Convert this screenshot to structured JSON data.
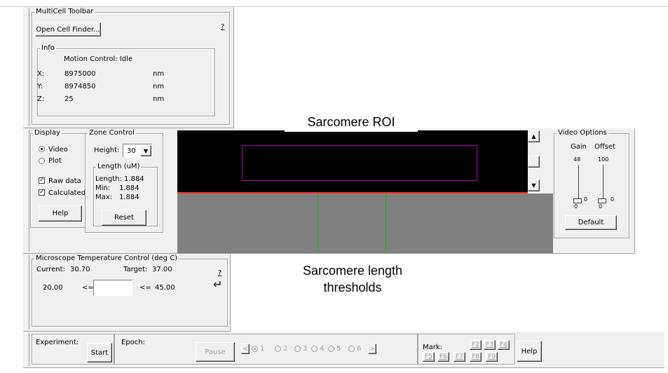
{
  "toolbar": {
    "title": "MultiCell Toolbar",
    "open_cell_finder": "Open Cell Finder...",
    "help_q": "?",
    "info": {
      "title": "Info",
      "motion_control": "Motion Control: Idle",
      "x_label": "X:",
      "x_value": "8975000",
      "x_unit": "nm",
      "y_label": "Y:",
      "y_value": "8974850",
      "y_unit": "nm",
      "z_label": "Z:",
      "z_value": "25",
      "z_unit": "nm"
    }
  },
  "display": {
    "title": "Display",
    "video": "Video",
    "plot": "Plot",
    "selected": "Video",
    "raw_data": "Raw data",
    "calculated": "Calculated",
    "raw_checked": true,
    "calc_checked": true,
    "help": "Help"
  },
  "zone": {
    "title": "Zone Control",
    "height_label": "Height:",
    "height_value": "30",
    "length_title": "Length (uM)",
    "length_line": "Length: 1.884",
    "min_label": "Min:",
    "min_value": "1.884",
    "max_label": "Max:",
    "max_value": "1.884",
    "reset": "Reset"
  },
  "video_options": {
    "title": "Video Options",
    "gain_label": "Gain",
    "offset_label": "Offset",
    "gain_max": "48",
    "offset_max": "100",
    "gain_min": "0",
    "offset_min": "0",
    "gain_value": "0",
    "offset_value": "0",
    "default": "Default"
  },
  "temperature": {
    "title": "Microscope Temperature Control (deg C)",
    "current_label": "Current:",
    "current_value": "30.70",
    "target_label": "Target:",
    "target_value": "37.00",
    "help_q": "?",
    "enter": "↵",
    "low": "20.00",
    "le1": "<=",
    "input_value": "",
    "le2": "<=",
    "high": "45.00"
  },
  "experiment": {
    "label": "Experiment:",
    "start": "Start",
    "epoch_label": "Epoch:",
    "pause": "Pause",
    "prev": "<",
    "next": ">",
    "epochs": [
      "1",
      "2",
      "3",
      "4",
      "5",
      "6"
    ],
    "selected_epoch": "1",
    "mark_label": "Mark:",
    "marks_row1": [
      "F2",
      "F3",
      "F4"
    ],
    "marks_row2": [
      "F5",
      "F6",
      "F7",
      "F8",
      "F9"
    ],
    "help": "Help"
  },
  "annotations": {
    "roi": "Sarcomere ROI",
    "thresholds_line1": "Sarcomere length",
    "thresholds_line2": "thresholds"
  },
  "colors": {
    "roi_box": "#c000c0",
    "threshold_line": "#00c000",
    "separator": "#ff0000",
    "plot_bg": "#808080",
    "video_bg": "#000000",
    "window_bg": "#f0f0f0"
  }
}
